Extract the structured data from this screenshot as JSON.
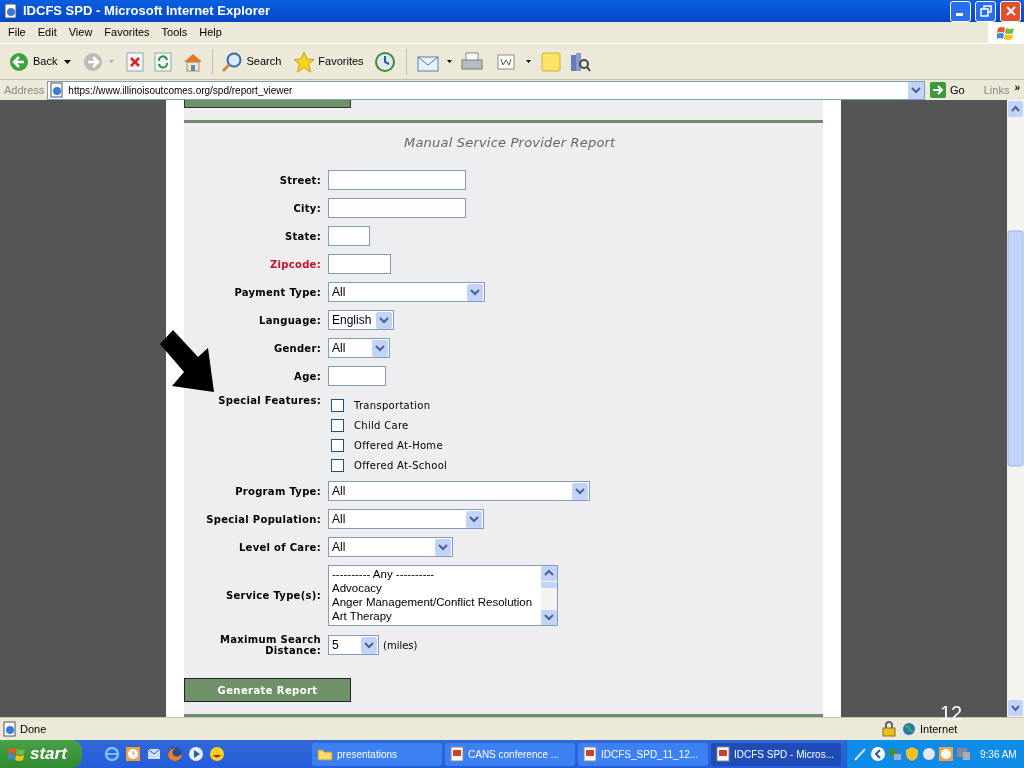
{
  "window": {
    "title": "IDCFS SPD - Microsoft Internet Explorer"
  },
  "menu": [
    "File",
    "Edit",
    "View",
    "Favorites",
    "Tools",
    "Help"
  ],
  "toolbar": {
    "back": "Back",
    "search": "Search",
    "favorites": "Favorites"
  },
  "address": {
    "label": "Address",
    "url": "https://www.illinoisoutcomes.org/spd/report_viewer",
    "go": "Go",
    "links": "Links",
    "more": "»"
  },
  "form": {
    "title": "Manual Service Provider Report",
    "fields": [
      {
        "kind": "text",
        "label": "Street:",
        "required": false
      },
      {
        "kind": "text",
        "label": "City:",
        "required": false
      },
      {
        "kind": "text",
        "label": "State:",
        "required": false
      },
      {
        "kind": "text",
        "label": "Zipcode:",
        "required": true
      },
      {
        "kind": "select",
        "label": "Payment Type:",
        "required": false,
        "value": "All"
      },
      {
        "kind": "select",
        "label": "Language:",
        "required": false,
        "value": "English"
      },
      {
        "kind": "select",
        "label": "Gender:",
        "required": false,
        "value": "All"
      },
      {
        "kind": "text",
        "label": "Age:",
        "required": false
      },
      {
        "kind": "checkboxes",
        "label": "Special Features:",
        "required": false,
        "options": [
          {
            "label": "Transportation",
            "checked": false
          },
          {
            "label": "Child Care",
            "checked": false
          },
          {
            "label": "Offered At-Home",
            "checked": false
          },
          {
            "label": "Offered At-School",
            "checked": false
          }
        ]
      },
      {
        "kind": "select",
        "label": "Program Type:",
        "required": false,
        "value": "All"
      },
      {
        "kind": "select",
        "label": "Special Population:",
        "required": false,
        "value": "All"
      },
      {
        "kind": "select",
        "label": "Level of Care:",
        "required": false,
        "value": "All"
      },
      {
        "kind": "listbox",
        "label": "Service Type(s):",
        "required": false,
        "options": [
          "---------- Any ----------",
          "Advocacy",
          "Anger Management/Conflict Resolution",
          "Art Therapy"
        ]
      },
      {
        "kind": "select",
        "label": "Maximum Search Distance:",
        "required": false,
        "value": "5",
        "unit": "(miles)"
      }
    ],
    "submit": "Generate Report"
  },
  "status_bar": {
    "text": "Done",
    "zone": "Internet"
  },
  "slide_number": "12",
  "taskbar": {
    "start": "start",
    "tasks": [
      {
        "label": "presentations",
        "selected": false
      },
      {
        "label": "CANS conference ...",
        "selected": false
      },
      {
        "label": "IDCFS_SPD_11_12...",
        "selected": false
      },
      {
        "label": "IDCFS SPD - Micros...",
        "selected": true
      }
    ],
    "clock": "9:36 AM"
  }
}
